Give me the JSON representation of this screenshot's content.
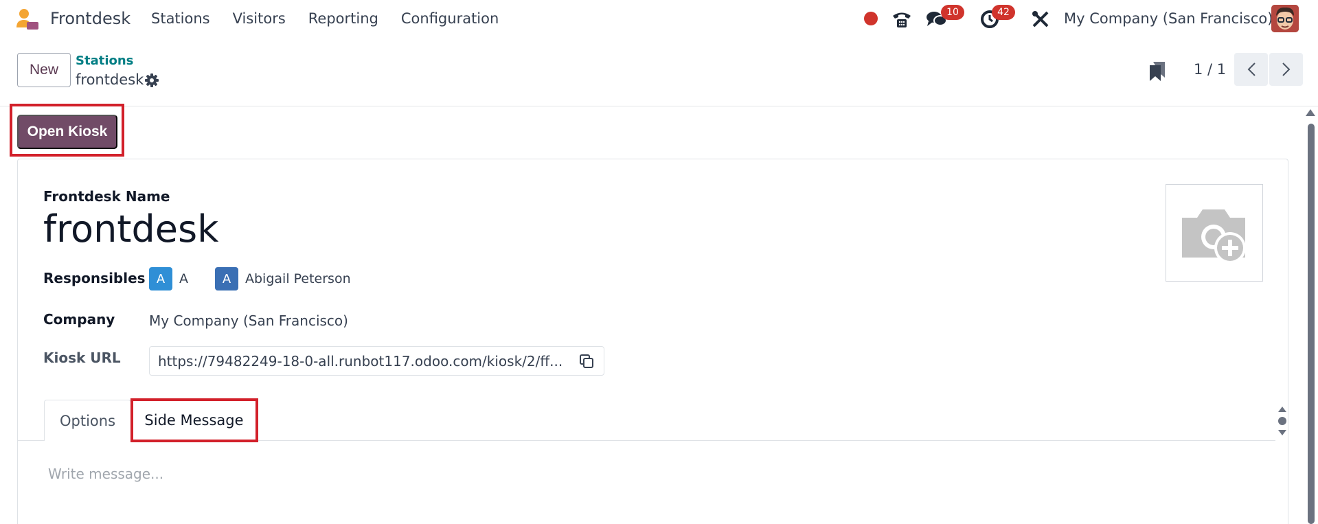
{
  "navbar": {
    "app_name": "Frontdesk",
    "menu": [
      "Stations",
      "Visitors",
      "Reporting",
      "Configuration"
    ],
    "messages_badge": "10",
    "activities_badge": "42",
    "company": "My Company (San Francisco)"
  },
  "control_panel": {
    "new_label": "New",
    "breadcrumb_parent": "Stations",
    "breadcrumb_current": "frontdesk",
    "pager": "1 / 1"
  },
  "statusbar": {
    "open_kiosk_label": "Open Kiosk"
  },
  "form": {
    "name_label": "Frontdesk Name",
    "name_value": "frontdesk",
    "responsibles_label": "Responsibles",
    "responsibles": [
      {
        "initial": "A",
        "name": "A",
        "color": "#2f8fd6"
      },
      {
        "initial": "A",
        "name": "Abigail Peterson",
        "color": "#3a6fb4"
      }
    ],
    "company_label": "Company",
    "company_value": "My Company (San Francisco)",
    "kiosk_url_label": "Kiosk URL",
    "kiosk_url_value": "https://79482249-18-0-all.runbot117.odoo.com/kiosk/2/ff..."
  },
  "tabs": [
    {
      "label": "Options",
      "active": false
    },
    {
      "label": "Side Message",
      "active": true
    }
  ],
  "side_message": {
    "placeholder": "Write message..."
  },
  "colors": {
    "brand": "#714b67",
    "link": "#017e84",
    "badge": "#d0342c",
    "highlight": "#d2202a"
  }
}
